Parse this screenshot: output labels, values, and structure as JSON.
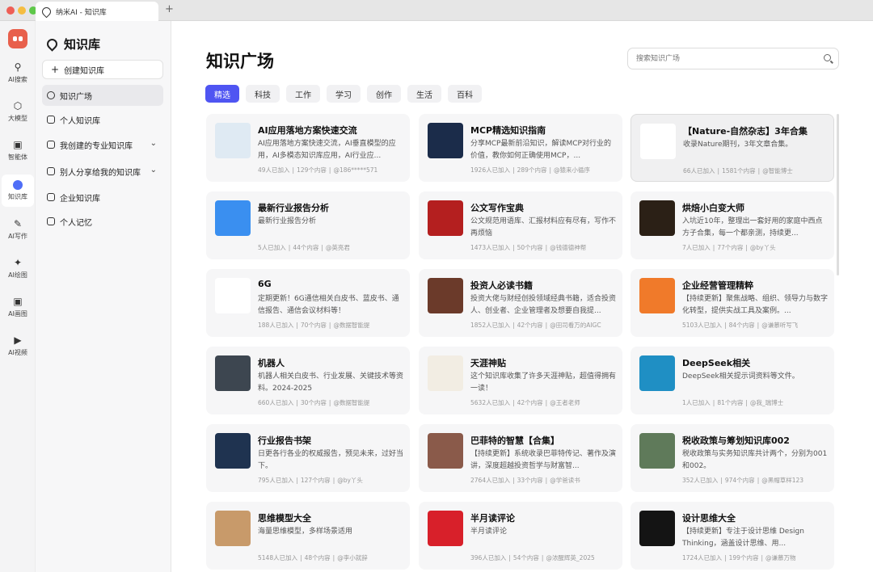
{
  "window": {
    "tab_title": "纳米AI - 知识库"
  },
  "rail": {
    "items": [
      {
        "label": "AI搜索",
        "icon": "search-icon"
      },
      {
        "label": "大模型",
        "icon": "hexagon-icon"
      },
      {
        "label": "智能体",
        "icon": "agent-icon"
      },
      {
        "label": "知识库",
        "icon": "knowledge-icon",
        "active": true
      },
      {
        "label": "AI写作",
        "icon": "pen-icon"
      },
      {
        "label": "AI绘图",
        "icon": "magic-icon"
      },
      {
        "label": "AI画图",
        "icon": "image-icon"
      },
      {
        "label": "AI视频",
        "icon": "video-icon"
      }
    ]
  },
  "sidebar": {
    "title": "知识库",
    "create_label": "创建知识库",
    "items": [
      {
        "label": "知识广场",
        "active": true
      },
      {
        "label": "个人知识库"
      },
      {
        "label": "我创建的专业知识库",
        "expandable": true
      },
      {
        "label": "别人分享给我的知识库",
        "expandable": true
      },
      {
        "label": "企业知识库"
      },
      {
        "label": "个人记忆"
      }
    ]
  },
  "main": {
    "title": "知识广场",
    "search_placeholder": "搜索知识广场",
    "chips": [
      "精选",
      "科技",
      "工作",
      "学习",
      "创作",
      "生活",
      "百科"
    ],
    "active_chip": "精选",
    "cards": [
      {
        "name": "AI应用落地方案快速交流",
        "desc": "AI应用落地方案快速交流，AI垂直模型的应用，AI多模态知识库应用，AI行业应...",
        "joined": "49人已加入",
        "count": "129个内容",
        "author": "@186*****571",
        "thumb": "#dfeaf3"
      },
      {
        "name": "MCP精选知识指南",
        "desc": "分享MCP最新前沿知识，解读MCP对行业的价值，教你如何正确使用MCP，...",
        "joined": "1926人已加入",
        "count": "289个内容",
        "author": "@猿来小循序",
        "thumb": "#1b2c4a"
      },
      {
        "name": "【Nature-自然杂志】3年合集",
        "desc": "收录Nature期刊，3年文章合集。",
        "joined": "66人已加入",
        "count": "1581个内容",
        "author": "@智能博士",
        "thumb": "#ffffff",
        "highlight": true
      },
      {
        "name": "最新行业报告分析",
        "desc": "最新行业报告分析",
        "joined": "5人已加入",
        "count": "44个内容",
        "author": "@英亮君",
        "thumb": "#3a8ff0"
      },
      {
        "name": "公文写作宝典",
        "desc": "公文规范用语库、汇报材料应有尽有，写作不再烦恼",
        "joined": "1473人已加入",
        "count": "50个内容",
        "author": "@钱德德神帮",
        "thumb": "#b41f1f"
      },
      {
        "name": "烘焙小白变大师",
        "desc": "入坑近10年，整理出一套好用的家庭中西点方子合集，每一个都亲测，持续更...",
        "joined": "7人已加入",
        "count": "77个内容",
        "author": "@by丫头",
        "thumb": "#2b2016"
      },
      {
        "name": "6G",
        "desc": "定期更新！6G通信相关白皮书、蓝皮书、通信报告、通信会议材料等！",
        "joined": "188人已加入",
        "count": "70个内容",
        "author": "@数据智能提",
        "thumb": "#ffffff"
      },
      {
        "name": "投资人必读书籍",
        "desc": "投资大佬与财经创投领域经典书籍，适合投资人、创业者、企业管理者及想要自我提...",
        "joined": "1852人已加入",
        "count": "42个内容",
        "author": "@田司看万的AIGC",
        "thumb": "#6b3a2a"
      },
      {
        "name": "企业经营管理精粹",
        "desc": "【持续更新】聚焦战略、组织、领导力与数字化转型，提供实战工具及案例。...",
        "joined": "5103人已加入",
        "count": "84个内容",
        "author": "@谦慕听写飞",
        "thumb": "#f07a2a"
      },
      {
        "name": "机器人",
        "desc": "机器人相关白皮书、行业发展、关键技术等资料。2024-2025",
        "joined": "660人已加入",
        "count": "30个内容",
        "author": "@数据智能提",
        "thumb": "#3d4650"
      },
      {
        "name": "天涯神贴",
        "desc": "这个知识库收集了许多天涯神贴，超值得拥有一读！",
        "joined": "5632人已加入",
        "count": "42个内容",
        "author": "@王者老师",
        "thumb": "#f2ede3"
      },
      {
        "name": "DeepSeek相关",
        "desc": "DeepSeek相关提示词资料等文件。",
        "joined": "1人已加入",
        "count": "81个内容",
        "author": "@我_瑞博士",
        "thumb": "#1f8fc4"
      },
      {
        "name": "行业报告书架",
        "desc": "日更各行各业的权威报告，预见未来，过好当下。",
        "joined": "795人已加入",
        "count": "127个内容",
        "author": "@by丫头",
        "thumb": "#1f3350"
      },
      {
        "name": "巴菲特的智慧【合集】",
        "desc": "【持续更新】系统收录巴菲特传记、著作及演讲，深度超越投资哲学与财富智...",
        "joined": "2764人已加入",
        "count": "33个内容",
        "author": "@学爸读书",
        "thumb": "#8a5a4a"
      },
      {
        "name": "税收政策与筹划知识库002",
        "desc": "税收政策与实务知识库共计两个，分别为001和002。",
        "joined": "352人已加入",
        "count": "974个内容",
        "author": "@黑帽草样123",
        "thumb": "#5f7a5a"
      },
      {
        "name": "思维模型大全",
        "desc": "海量思维模型，多样场景适用",
        "joined": "5148人已加入",
        "count": "48个内容",
        "author": "@李小就辞",
        "thumb": "#c89a6a"
      },
      {
        "name": "半月读评论",
        "desc": "半月读评论",
        "joined": "396人已加入",
        "count": "54个内容",
        "author": "@浓醒辉英_2025",
        "thumb": "#d8202a"
      },
      {
        "name": "设计思维大全",
        "desc": "【持续更新】专注于设计思维 Design Thinking，涵盖设计思维、用...",
        "joined": "1724人已加入",
        "count": "199个内容",
        "author": "@谦慕万物",
        "thumb": "#141414"
      }
    ]
  }
}
